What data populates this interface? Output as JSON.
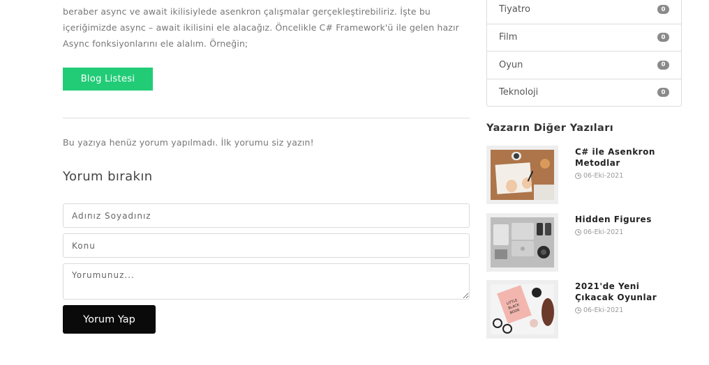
{
  "article": {
    "intro_lines": [
      "beraber async ve await ikilisiylede asenkron çalışmalar gerçekleştirebiliriz. İşte bu",
      "içeriğimizde async – await ikilisini ele alacağız. Öncelikle C# Framework'ü ile gelen hazır",
      "Async fonksiyonlarını ele alalım. Örneğin;"
    ],
    "blog_list_button": "Blog Listesi"
  },
  "comments": {
    "empty_message": "Bu yazıya henüz yorum yapılmadı. İlk yorumu siz yazın!",
    "heading": "Yorum bırakın",
    "name_placeholder": "Adınız Soyadınız",
    "subject_placeholder": "Konu",
    "comment_placeholder": "Yorumunuz...",
    "submit_label": "Yorum Yap"
  },
  "sidebar": {
    "categories": [
      {
        "label": "Tiyatro",
        "count": "0"
      },
      {
        "label": "Film",
        "count": "0"
      },
      {
        "label": "Oyun",
        "count": "0"
      },
      {
        "label": "Teknoloji",
        "count": "0"
      }
    ],
    "other_posts_heading": "Yazarın Diğer Yazıları",
    "other_posts": [
      {
        "title": "C# ile Asenkron Metodlar",
        "date": "06-Eki-2021",
        "thumb_icon": "notebook-desk-photo"
      },
      {
        "title": "Hidden Figures",
        "date": "06-Eki-2021",
        "thumb_icon": "laptop-gadgets-photo"
      },
      {
        "title": "2021'de Yeni Çıkacak Oyunlar",
        "date": "06-Eki-2021",
        "thumb_icon": "little-black-book-photo"
      }
    ]
  },
  "colors": {
    "accent_green": "#22cc77",
    "submit_black": "#0a0a0a",
    "badge_gray": "#8a8a8a"
  }
}
